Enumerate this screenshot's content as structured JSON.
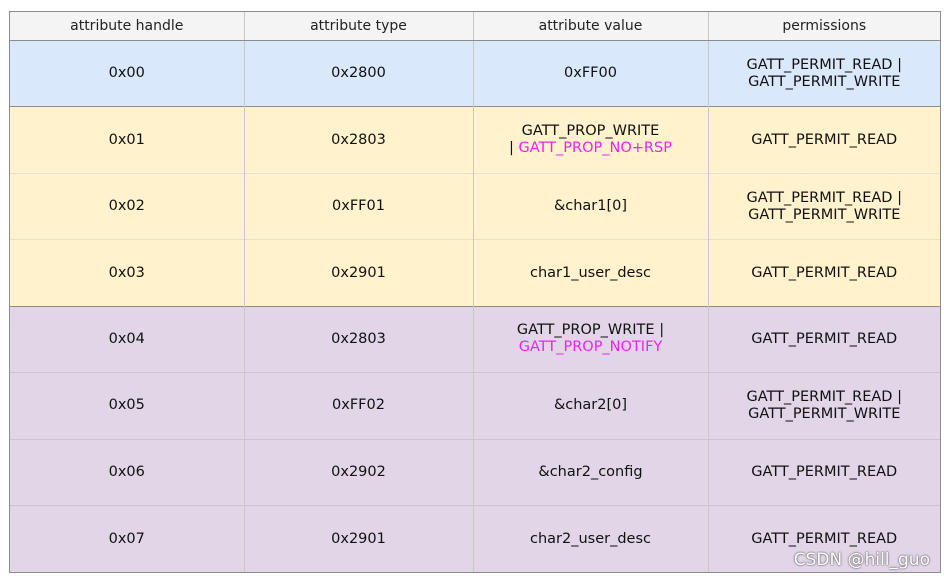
{
  "table": {
    "headers": [
      "attribute handle",
      "attribute type",
      "attribute value",
      "permissions"
    ],
    "rows": [
      {
        "handle": "0x00",
        "type": "0x2800",
        "value": [
          "0xFF00"
        ],
        "value_highlight": "",
        "permissions": [
          "GATT_PERMIT_READ |",
          "GATT_PERMIT_WRITE"
        ]
      },
      {
        "handle": "0x01",
        "type": "0x2803",
        "value": [
          "GATT_PROP_WRITE",
          "| "
        ],
        "value_highlight": "GATT_PROP_NO+RSP",
        "permissions": [
          "GATT_PERMIT_READ"
        ]
      },
      {
        "handle": "0x02",
        "type": "0xFF01",
        "value": [
          "&char1[0]"
        ],
        "value_highlight": "",
        "permissions": [
          "GATT_PERMIT_READ |",
          "GATT_PERMIT_WRITE"
        ]
      },
      {
        "handle": "0x03",
        "type": "0x2901",
        "value": [
          "char1_user_desc"
        ],
        "value_highlight": "",
        "permissions": [
          "GATT_PERMIT_READ"
        ]
      },
      {
        "handle": "0x04",
        "type": "0x2803",
        "value": [
          "GATT_PROP_WRITE |",
          ""
        ],
        "value_highlight": "GATT_PROP_NOTIFY",
        "permissions": [
          "GATT_PERMIT_READ"
        ]
      },
      {
        "handle": "0x05",
        "type": "0xFF02",
        "value": [
          "&char2[0]"
        ],
        "value_highlight": "",
        "permissions": [
          "GATT_PERMIT_READ |",
          "GATT_PERMIT_WRITE"
        ]
      },
      {
        "handle": "0x06",
        "type": "0x2902",
        "value": [
          "&char2_config"
        ],
        "value_highlight": "",
        "permissions": [
          "GATT_PERMIT_READ"
        ]
      },
      {
        "handle": "0x07",
        "type": "0x2901",
        "value": [
          "char2_user_desc"
        ],
        "value_highlight": "",
        "permissions": [
          "GATT_PERMIT_READ"
        ]
      }
    ],
    "group_colors": {
      "blue": "#dae8fc",
      "yellow": "#fff2cc",
      "purple": "#e1d5e7"
    },
    "highlight_color": "#ee22ee"
  },
  "watermark": "CSDN @hill_guo"
}
